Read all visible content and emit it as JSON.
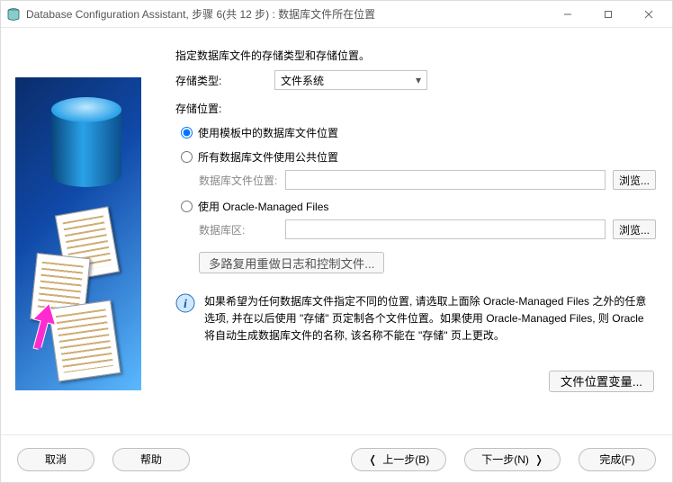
{
  "window": {
    "title": "Database Configuration Assistant, 步骤 6(共 12 步) : 数据库文件所在位置"
  },
  "main": {
    "intro": "指定数据库文件的存储类型和存储位置。",
    "storage_type_label": "存储类型:",
    "storage_type_value": "文件系统",
    "storage_location_label": "存储位置:",
    "radio": {
      "template": "使用模板中的数据库文件位置",
      "common": "所有数据库文件使用公共位置",
      "omf": "使用 Oracle-Managed Files"
    },
    "fields": {
      "db_file_loc_label": "数据库文件位置:",
      "db_area_label": "数据库区:",
      "browse": "浏览..."
    },
    "multiplex_button": "多路复用重做日志和控制文件...",
    "info_text": "如果希望为任何数据库文件指定不同的位置, 请选取上面除 Oracle-Managed Files 之外的任意选项, 并在以后使用 \"存储\" 页定制各个文件位置。如果使用 Oracle-Managed Files, 则 Oracle 将自动生成数据库文件的名称, 该名称不能在 \"存储\" 页上更改。",
    "file_loc_vars_button": "文件位置变量..."
  },
  "footer": {
    "cancel": "取消",
    "help": "帮助",
    "back": "上一步(B)",
    "next": "下一步(N)",
    "finish": "完成(F)"
  }
}
